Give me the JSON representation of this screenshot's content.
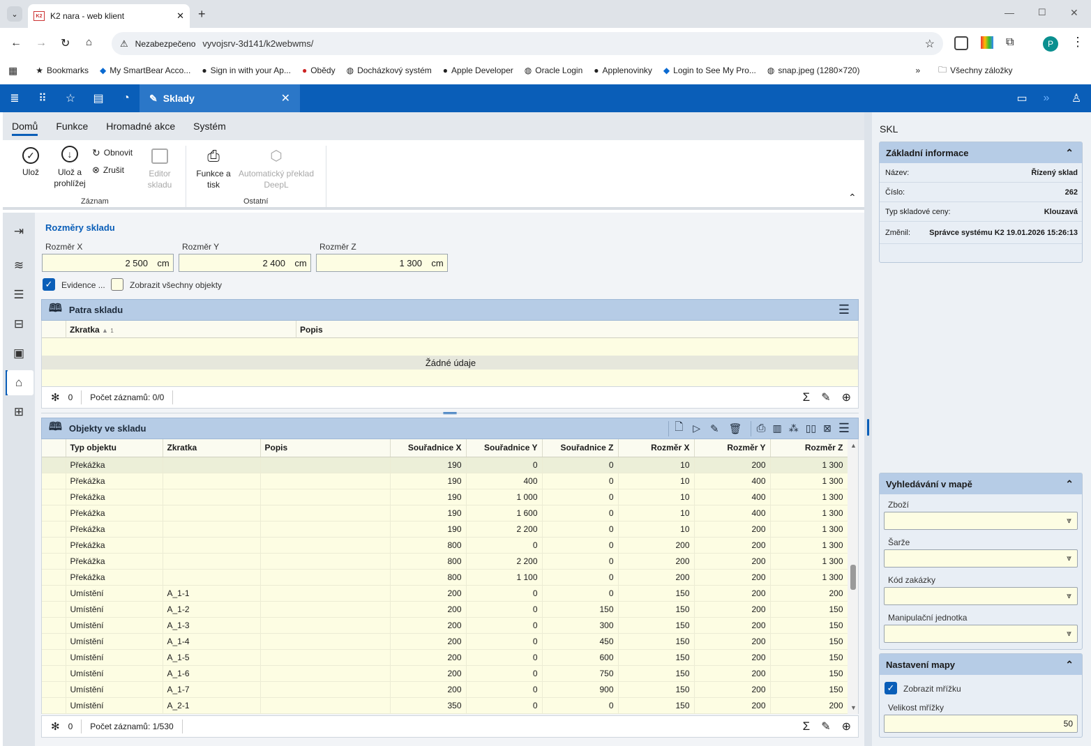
{
  "browser": {
    "tab_title": "K2 nara - web klient",
    "security_label": "Nezabezpečeno",
    "url": "vyvojsrv-3d141/k2webwms/",
    "bookmarks": [
      "Bookmarks",
      "My SmartBear Acco...",
      "Sign in with your Ap...",
      "Obědy",
      "Docházkový systém",
      "Apple Developer",
      "Oracle Login",
      "Applenovinky",
      "Login to See My Pro...",
      "snap.jpeg (1280×720)"
    ],
    "all_bookmarks": "Všechny záložky",
    "profile_initial": "P"
  },
  "app": {
    "tab_label": "Sklady"
  },
  "menu": [
    "Domů",
    "Funkce",
    "Hromadné akce",
    "Systém"
  ],
  "ribbon": {
    "save": "Ulož",
    "save_view": "Ulož a prohlížej",
    "refresh": "Obnovit",
    "cancel": "Zrušit",
    "editor": "Editor skladu",
    "group_record": "Záznam",
    "func_print": "Funkce a tisk",
    "deepl": "Automatický překlad DeepL",
    "group_other": "Ostatní"
  },
  "dims": {
    "title": "Rozměry skladu",
    "x_label": "Rozměr X",
    "x_value": "2 500",
    "y_label": "Rozměr Y",
    "y_value": "2 400",
    "z_label": "Rozměr Z",
    "z_value": "1 300",
    "unit": "cm",
    "evidence_label": "Evidence ...",
    "show_all_label": "Zobrazit všechny objekty"
  },
  "floors": {
    "title": "Patra skladu",
    "col_code": "Zkratka",
    "sort_index": "1",
    "col_desc": "Popis",
    "empty": "Žádné údaje",
    "filter_count": "0",
    "record_count": "Počet záznamů: 0/0"
  },
  "objects": {
    "title": "Objekty ve skladu",
    "columns": [
      "Typ objektu",
      "Zkratka",
      "Popis",
      "Souřadnice X",
      "Souřadnice Y",
      "Souřadnice Z",
      "Rozměr X",
      "Rozměr Y",
      "Rozměr Z"
    ],
    "rows": [
      [
        "Překážka",
        "",
        "",
        "190",
        "0",
        "0",
        "10",
        "200",
        "1 300"
      ],
      [
        "Překážka",
        "",
        "",
        "190",
        "400",
        "0",
        "10",
        "400",
        "1 300"
      ],
      [
        "Překážka",
        "",
        "",
        "190",
        "1 000",
        "0",
        "10",
        "400",
        "1 300"
      ],
      [
        "Překážka",
        "",
        "",
        "190",
        "1 600",
        "0",
        "10",
        "400",
        "1 300"
      ],
      [
        "Překážka",
        "",
        "",
        "190",
        "2 200",
        "0",
        "10",
        "200",
        "1 300"
      ],
      [
        "Překážka",
        "",
        "",
        "800",
        "0",
        "0",
        "200",
        "200",
        "1 300"
      ],
      [
        "Překážka",
        "",
        "",
        "800",
        "2 200",
        "0",
        "200",
        "200",
        "1 300"
      ],
      [
        "Překážka",
        "",
        "",
        "800",
        "1 100",
        "0",
        "200",
        "200",
        "1 300"
      ],
      [
        "Umístění",
        "A_1-1",
        "",
        "200",
        "0",
        "0",
        "150",
        "200",
        "200"
      ],
      [
        "Umístění",
        "A_1-2",
        "",
        "200",
        "0",
        "150",
        "150",
        "200",
        "150"
      ],
      [
        "Umístění",
        "A_1-3",
        "",
        "200",
        "0",
        "300",
        "150",
        "200",
        "150"
      ],
      [
        "Umístění",
        "A_1-4",
        "",
        "200",
        "0",
        "450",
        "150",
        "200",
        "150"
      ],
      [
        "Umístění",
        "A_1-5",
        "",
        "200",
        "0",
        "600",
        "150",
        "200",
        "150"
      ],
      [
        "Umístění",
        "A_1-6",
        "",
        "200",
        "0",
        "750",
        "150",
        "200",
        "150"
      ],
      [
        "Umístění",
        "A_1-7",
        "",
        "200",
        "0",
        "900",
        "150",
        "200",
        "150"
      ],
      [
        "Umístění",
        "A_2-1",
        "",
        "350",
        "0",
        "0",
        "150",
        "200",
        "200"
      ]
    ],
    "filter_count": "0",
    "record_count": "Počet záznamů: 1/530"
  },
  "right": {
    "code": "SKL",
    "basic_title": "Základní informace",
    "name_label": "Název:",
    "name_value": "Řízený sklad",
    "number_label": "Číslo:",
    "number_value": "262",
    "price_label": "Typ skladové ceny:",
    "price_value": "Klouzavá",
    "changed_label": "Změnil:",
    "changed_value": "Správce systému K2 19.01.2026 15:26:13",
    "search_title": "Vyhledávání v mapě",
    "goods_label": "Zboží",
    "batch_label": "Šarže",
    "order_label": "Kód zakázky",
    "unit_label": "Manipulační jednotka",
    "map_title": "Nastavení mapy",
    "show_grid_label": "Zobrazit mřížku",
    "grid_size_label": "Velikost mřížky",
    "grid_size_value": "50"
  }
}
